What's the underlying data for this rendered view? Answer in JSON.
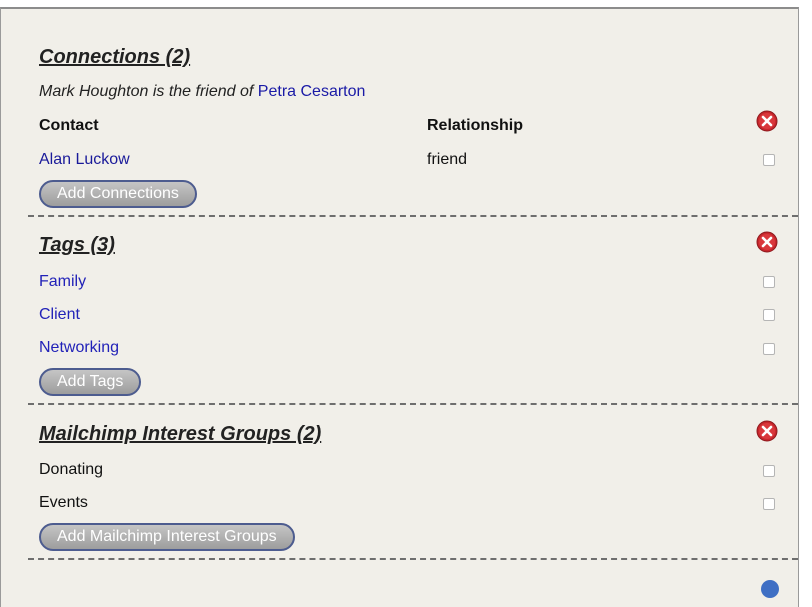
{
  "connections": {
    "heading": "Connections (2)",
    "note_prefix": "Mark Houghton is the friend of",
    "note_link": "Petra Cesarton",
    "col_contact": "Contact",
    "col_relationship": "Relationship",
    "rows": [
      {
        "contact": "Alan Luckow",
        "relationship": "friend"
      }
    ],
    "add_button": "Add Connections"
  },
  "tags": {
    "heading": "Tags (3)",
    "items": [
      "Family",
      "Client",
      "Networking"
    ],
    "add_button": "Add Tags"
  },
  "mailchimp": {
    "heading": "Mailchimp Interest Groups (2)",
    "items": [
      "Donating",
      "Events"
    ],
    "add_button": "Add Mailchimp Interest Groups"
  },
  "icons": {
    "delete": "delete-icon",
    "help": "help-icon"
  },
  "colors": {
    "panel_bg": "#f1efe9",
    "link": "#2222b8",
    "delete_red": "#c7262c",
    "button_border": "#4d5c8f"
  }
}
